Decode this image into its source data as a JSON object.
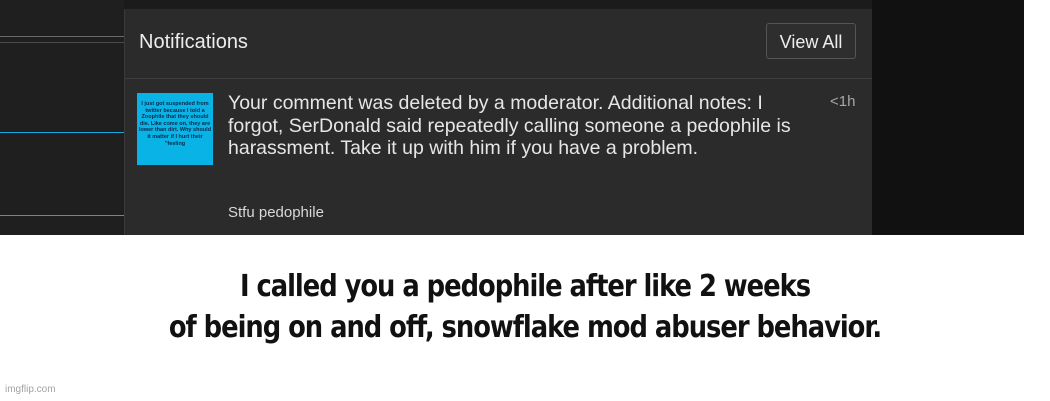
{
  "notifications": {
    "title": "Notifications",
    "view_all_label": "View All",
    "item": {
      "thumbnail_text": "I just got suspended from twitter because I told a Zoophile that they should die. Like come on, they are lower than dirt. Why should it matter if I hurt their \"feeling",
      "message": "Your comment was deleted by a moderator. Additional notes: I forgot, SerDonald said repeatedly calling someone a pedophile is harassment. Take it up with him if you have a problem.",
      "time": "<1h",
      "comment_excerpt": "Stfu pedophile"
    }
  },
  "caption": {
    "line1": "I called you a pedophile after like 2 weeks",
    "line2": "of being on and off, snowflake mod abuser behavior."
  },
  "watermark": "imgflip.com",
  "colors": {
    "thumbnail_bg": "#0ab3e6",
    "panel_bg": "#2b2b2b",
    "page_bg": "#1b1b1b",
    "accent_line": "#13a9dc"
  }
}
